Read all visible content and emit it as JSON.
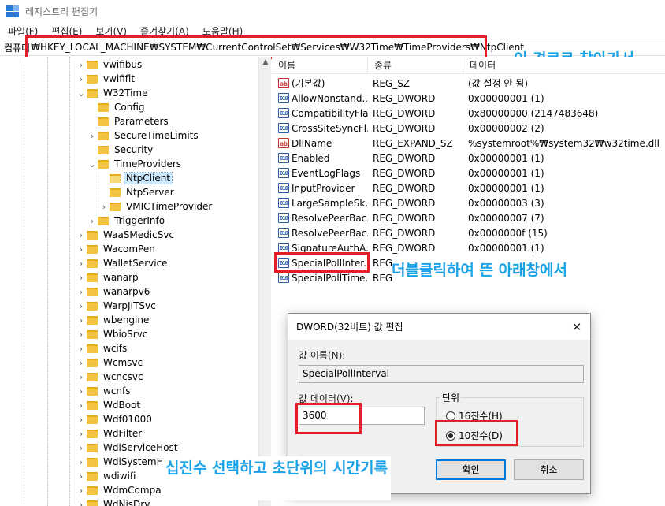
{
  "window": {
    "title": "레지스트리 편집기"
  },
  "menu": [
    "파일(F)",
    "편집(E)",
    "보기(V)",
    "즐겨찾기(A)",
    "도움말(H)"
  ],
  "address": {
    "label": "컴퓨터",
    "path": "₩HKEY_LOCAL_MACHINE₩SYSTEM₩CurrentControlSet₩Services₩W32Time₩TimeProviders₩NtpClient"
  },
  "tree": {
    "items": [
      {
        "label": "vwifibus",
        "depth": 0,
        "chevron": "›"
      },
      {
        "label": "vwififlt",
        "depth": 0,
        "chevron": "›"
      },
      {
        "label": "W32Time",
        "depth": 0,
        "chevron": "⌄"
      },
      {
        "label": "Config",
        "depth": 1,
        "chevron": ""
      },
      {
        "label": "Parameters",
        "depth": 1,
        "chevron": ""
      },
      {
        "label": "SecureTimeLimits",
        "depth": 1,
        "chevron": "›"
      },
      {
        "label": "Security",
        "depth": 1,
        "chevron": ""
      },
      {
        "label": "TimeProviders",
        "depth": 1,
        "chevron": "⌄"
      },
      {
        "label": "NtpClient",
        "depth": 2,
        "chevron": "",
        "selected": true
      },
      {
        "label": "NtpServer",
        "depth": 2,
        "chevron": ""
      },
      {
        "label": "VMICTimeProvider",
        "depth": 2,
        "chevron": "›"
      },
      {
        "label": "TriggerInfo",
        "depth": 1,
        "chevron": "›"
      },
      {
        "label": "WaaSMedicSvc",
        "depth": 0,
        "chevron": "›"
      },
      {
        "label": "WacomPen",
        "depth": 0,
        "chevron": "›"
      },
      {
        "label": "WalletService",
        "depth": 0,
        "chevron": "›"
      },
      {
        "label": "wanarp",
        "depth": 0,
        "chevron": "›"
      },
      {
        "label": "wanarpv6",
        "depth": 0,
        "chevron": "›"
      },
      {
        "label": "WarpJITSvc",
        "depth": 0,
        "chevron": "›"
      },
      {
        "label": "wbengine",
        "depth": 0,
        "chevron": "›"
      },
      {
        "label": "WbioSrvc",
        "depth": 0,
        "chevron": "›"
      },
      {
        "label": "wcifs",
        "depth": 0,
        "chevron": "›"
      },
      {
        "label": "Wcmsvc",
        "depth": 0,
        "chevron": "›"
      },
      {
        "label": "wcncsvc",
        "depth": 0,
        "chevron": "›"
      },
      {
        "label": "wcnfs",
        "depth": 0,
        "chevron": "›"
      },
      {
        "label": "WdBoot",
        "depth": 0,
        "chevron": "›"
      },
      {
        "label": "Wdf01000",
        "depth": 0,
        "chevron": "›"
      },
      {
        "label": "WdFilter",
        "depth": 0,
        "chevron": "›"
      },
      {
        "label": "WdiServiceHost",
        "depth": 0,
        "chevron": "›"
      },
      {
        "label": "WdiSystemHost",
        "depth": 0,
        "chevron": "›"
      },
      {
        "label": "wdiwifi",
        "depth": 0,
        "chevron": "›"
      },
      {
        "label": "WdmCompanio",
        "depth": 0,
        "chevron": "›"
      },
      {
        "label": "WdNisDrv",
        "depth": 0,
        "chevron": "›"
      }
    ]
  },
  "list": {
    "columns": [
      "이름",
      "종류",
      "데이터"
    ],
    "rows": [
      {
        "icon": "string-value-icon",
        "name": "(기본값)",
        "type": "REG_SZ",
        "data": "(값 설정 안 됨)"
      },
      {
        "icon": "binary-value-icon",
        "name": "AllowNonstand...",
        "type": "REG_DWORD",
        "data": "0x00000001 (1)"
      },
      {
        "icon": "binary-value-icon",
        "name": "CompatibilityFla...",
        "type": "REG_DWORD",
        "data": "0x80000000 (2147483648)"
      },
      {
        "icon": "binary-value-icon",
        "name": "CrossSiteSyncFl...",
        "type": "REG_DWORD",
        "data": "0x00000002 (2)"
      },
      {
        "icon": "string-value-icon",
        "name": "DllName",
        "type": "REG_EXPAND_SZ",
        "data": "%systemroot%₩system32₩w32time.dll"
      },
      {
        "icon": "binary-value-icon",
        "name": "Enabled",
        "type": "REG_DWORD",
        "data": "0x00000001 (1)"
      },
      {
        "icon": "binary-value-icon",
        "name": "EventLogFlags",
        "type": "REG_DWORD",
        "data": "0x00000001 (1)"
      },
      {
        "icon": "binary-value-icon",
        "name": "InputProvider",
        "type": "REG_DWORD",
        "data": "0x00000001 (1)"
      },
      {
        "icon": "binary-value-icon",
        "name": "LargeSampleSk...",
        "type": "REG_DWORD",
        "data": "0x00000003 (3)"
      },
      {
        "icon": "binary-value-icon",
        "name": "ResolvePeerBac...",
        "type": "REG_DWORD",
        "data": "0x00000007 (7)"
      },
      {
        "icon": "binary-value-icon",
        "name": "ResolvePeerBac...",
        "type": "REG_DWORD",
        "data": "0x0000000f (15)"
      },
      {
        "icon": "binary-value-icon",
        "name": "SignatureAuthA...",
        "type": "REG_DWORD",
        "data": "0x00000001 (1)"
      },
      {
        "icon": "binary-value-icon",
        "name": "SpecialPollInter...",
        "type": "REG",
        "data": ""
      },
      {
        "icon": "binary-value-icon",
        "name": "SpecialPollTime...",
        "type": "REG",
        "data": ""
      }
    ]
  },
  "annotations": {
    "path_note": "이 경로로 찾아가서",
    "dblclick_note": "더블클릭하여 뜬 아래창에서",
    "decimal_note": "십진수 선택하고 초단위의 시간기록"
  },
  "dialog": {
    "title": "DWORD(32비트) 값 편집",
    "close": "✕",
    "name_label": "값 이름(N):",
    "name_value": "SpecialPollInterval",
    "data_label": "값 데이터(V):",
    "data_value": "3600",
    "base_label": "단위",
    "hex_label": "16진수(H)",
    "dec_label": "10진수(D)",
    "selected_base": "decimal",
    "ok": "확인",
    "cancel": "취소"
  }
}
